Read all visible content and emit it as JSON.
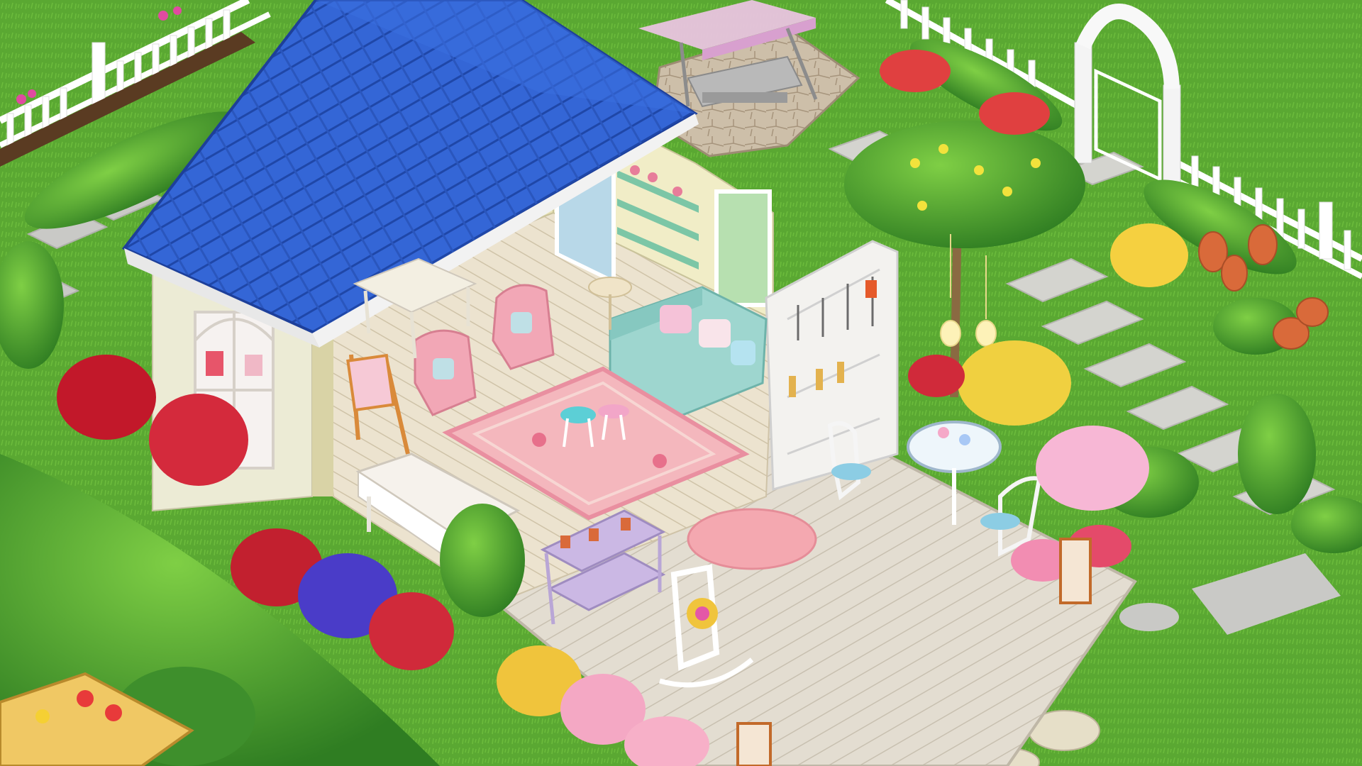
{
  "scene": {
    "kind": "isometric garden room",
    "objects": [
      "garden-cottage",
      "blue-shingle-roof",
      "pink-armchair",
      "pink-armchair",
      "mint-sofa",
      "floral-rug",
      "coffee-tables",
      "painting-easel",
      "craft-desk",
      "wall-shelf",
      "garden-tool-cabinet",
      "patio-deck",
      "tea-table",
      "white-chair",
      "blue-chair",
      "rocking-chair",
      "oval-rug",
      "plant-stand",
      "porch-swing",
      "flowering-tree",
      "white-picket-fence",
      "garden-arch-gate",
      "stepping-stones",
      "lanterns",
      "flower-beds",
      "hedges",
      "terracotta-pots",
      "wheelbarrow-planter"
    ]
  },
  "colors": {
    "lawn": "#5aa832",
    "lawn_light": "#7cc644",
    "roof": "#2f5fd0",
    "roof_dark": "#1d3f9a",
    "wall": "#f1edc7",
    "wall_shade": "#d9d3a6",
    "floor": "#e8dcc4",
    "deck": "#ddd6c8",
    "sofa": "#9ed6cf",
    "armchair": "#f2a7b6",
    "rug": "#f4b7bd",
    "paving": "#c9c9c6",
    "fence": "#ffffff",
    "hedge": "#3e8f2c",
    "path": "#d4b896",
    "terracotta": "#d96a3a"
  }
}
